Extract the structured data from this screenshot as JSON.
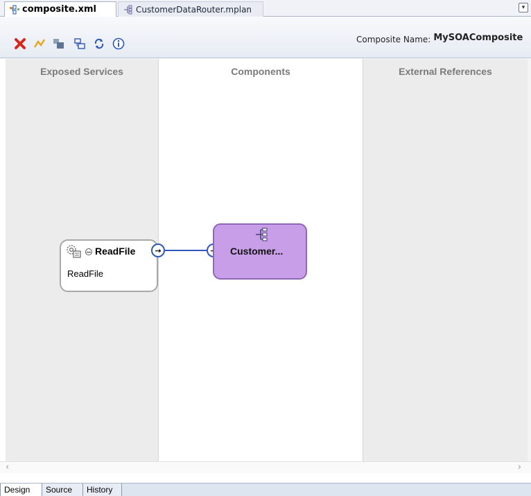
{
  "tabs": [
    {
      "label": "composite.xml",
      "icon": "composite-icon",
      "active": true
    },
    {
      "label": "CustomerDataRouter.mplan",
      "icon": "mediator-icon",
      "active": false
    }
  ],
  "toolbar": {
    "buttons": [
      "delete-icon",
      "wire-icon",
      "component-icon",
      "layout-icon",
      "refresh-icon",
      "info-icon"
    ],
    "composite_name_label": "Composite Name:",
    "composite_name_value": "MySOAComposite"
  },
  "lanes": {
    "services": "Exposed Services",
    "components": "Components",
    "external": "External References"
  },
  "service": {
    "name": "ReadFile",
    "subtitle": "ReadFile"
  },
  "component": {
    "name": "Customer..."
  },
  "ports": {
    "arrow": "→"
  },
  "bottom_tabs": [
    "Design",
    "Source",
    "History"
  ],
  "colors": {
    "wire": "#2f57b8",
    "component_fill": "#c79ee7",
    "lane_gray": "#ececec"
  }
}
